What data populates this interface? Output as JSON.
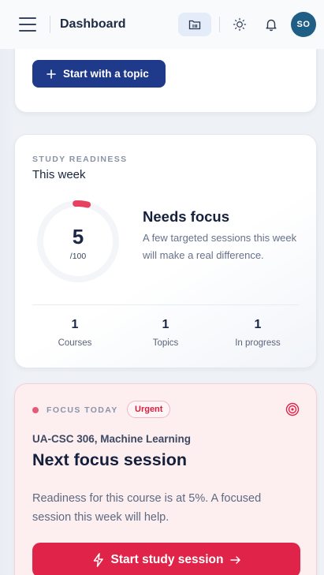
{
  "header": {
    "title": "Dashboard",
    "avatar_initials": "SO"
  },
  "top_card": {
    "start_topic_label": "Start with a topic"
  },
  "readiness": {
    "eyebrow": "STUDY READINESS",
    "period": "This week",
    "score": "5",
    "score_denominator": "/100",
    "score_value": 5,
    "status_title": "Needs focus",
    "status_description": "A few targeted sessions this week will make a real difference.",
    "stats": [
      {
        "value": "1",
        "label": "Courses"
      },
      {
        "value": "1",
        "label": "Topics"
      },
      {
        "value": "1",
        "label": "In progress"
      }
    ]
  },
  "focus": {
    "eyebrow": "FOCUS TODAY",
    "badge": "Urgent",
    "course": "UA-CSC 306, Machine Learning",
    "title": "Next focus session",
    "description": "Readiness for this course is at 5%. A focused session this week will help.",
    "button_label": "Start study session"
  },
  "colors": {
    "primary": "#1f3a8a",
    "urgent": "#e02449",
    "ring_accent": "#e8405f",
    "avatar": "#1f5f86"
  }
}
